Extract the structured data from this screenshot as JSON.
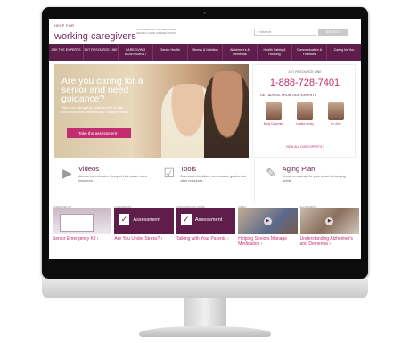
{
  "site": {
    "logo_small": "HELP FOR",
    "logo_main": "working caregivers",
    "tagline": "A FOUNDATION OF PERSONAL HEALTH CARE CONNECTIONS",
    "search_placeholder": "Search",
    "search_button": "SEARCH"
  },
  "nav": {
    "items": [
      "ASK THE EXPERTS",
      "24/7 RESOURCE LINE",
      "CAREGIVING ASSESSMENT",
      "Senior Health",
      "Fitness & Nutrition",
      "Alzheimer's & Dementia",
      "Health Safety & Housing",
      "Communication & Finances",
      "Caring for You"
    ]
  },
  "hero": {
    "title": "Are you caring for a senior and need guidance?",
    "subtitle": "Take our caregiving assessment to find resources that address your unique needs.",
    "button": "Take the assessment ›"
  },
  "help": {
    "line_label": "24/7 RESOURCE LINE",
    "phone": "1-888-728-7401",
    "advice_label": "GET ADVICE FROM OUR EXPERTS",
    "experts": [
      {
        "name": "Molly Carpenter"
      },
      {
        "name": "Loretta Veney"
      },
      {
        "name": "Dr. Amy"
      }
    ],
    "link": "VIEW ALL OUR EXPERTS ›"
  },
  "features": [
    {
      "icon": "play-circle-icon",
      "glyph": "▶",
      "title": "Videos",
      "text": "Access our extensive library of informative video resources."
    },
    {
      "icon": "clipboard-check-icon",
      "glyph": "☑",
      "title": "Tools",
      "text": "Download checklists, conversation guides and other resources."
    },
    {
      "icon": "document-edit-icon",
      "glyph": "✎",
      "title": "Aging Plan",
      "text": "Create a roadmap for your senior's changing needs."
    }
  ],
  "cards": [
    {
      "tag": "CAREGIVER KIT",
      "title": "Senior Emergency Kit ›",
      "type": "kit"
    },
    {
      "tag": "ASSESSMENT",
      "title": "Are You Under Stress? ›",
      "type": "assess",
      "label": "Assessment"
    },
    {
      "tag": "CONVERSATION GUIDE",
      "title": "Talking with Your Parents ›",
      "type": "assess",
      "label": "Assessment"
    },
    {
      "tag": "VIDEO",
      "title": "Helping Seniors Manage Medication ›",
      "type": "video"
    },
    {
      "tag": "ALZHEIMER'S",
      "title": "Understanding Alzheimer's and Dementia ›",
      "type": "video"
    }
  ],
  "colors": {
    "brand_purple": "#5e1d4a",
    "accent_pink": "#c22d70"
  }
}
